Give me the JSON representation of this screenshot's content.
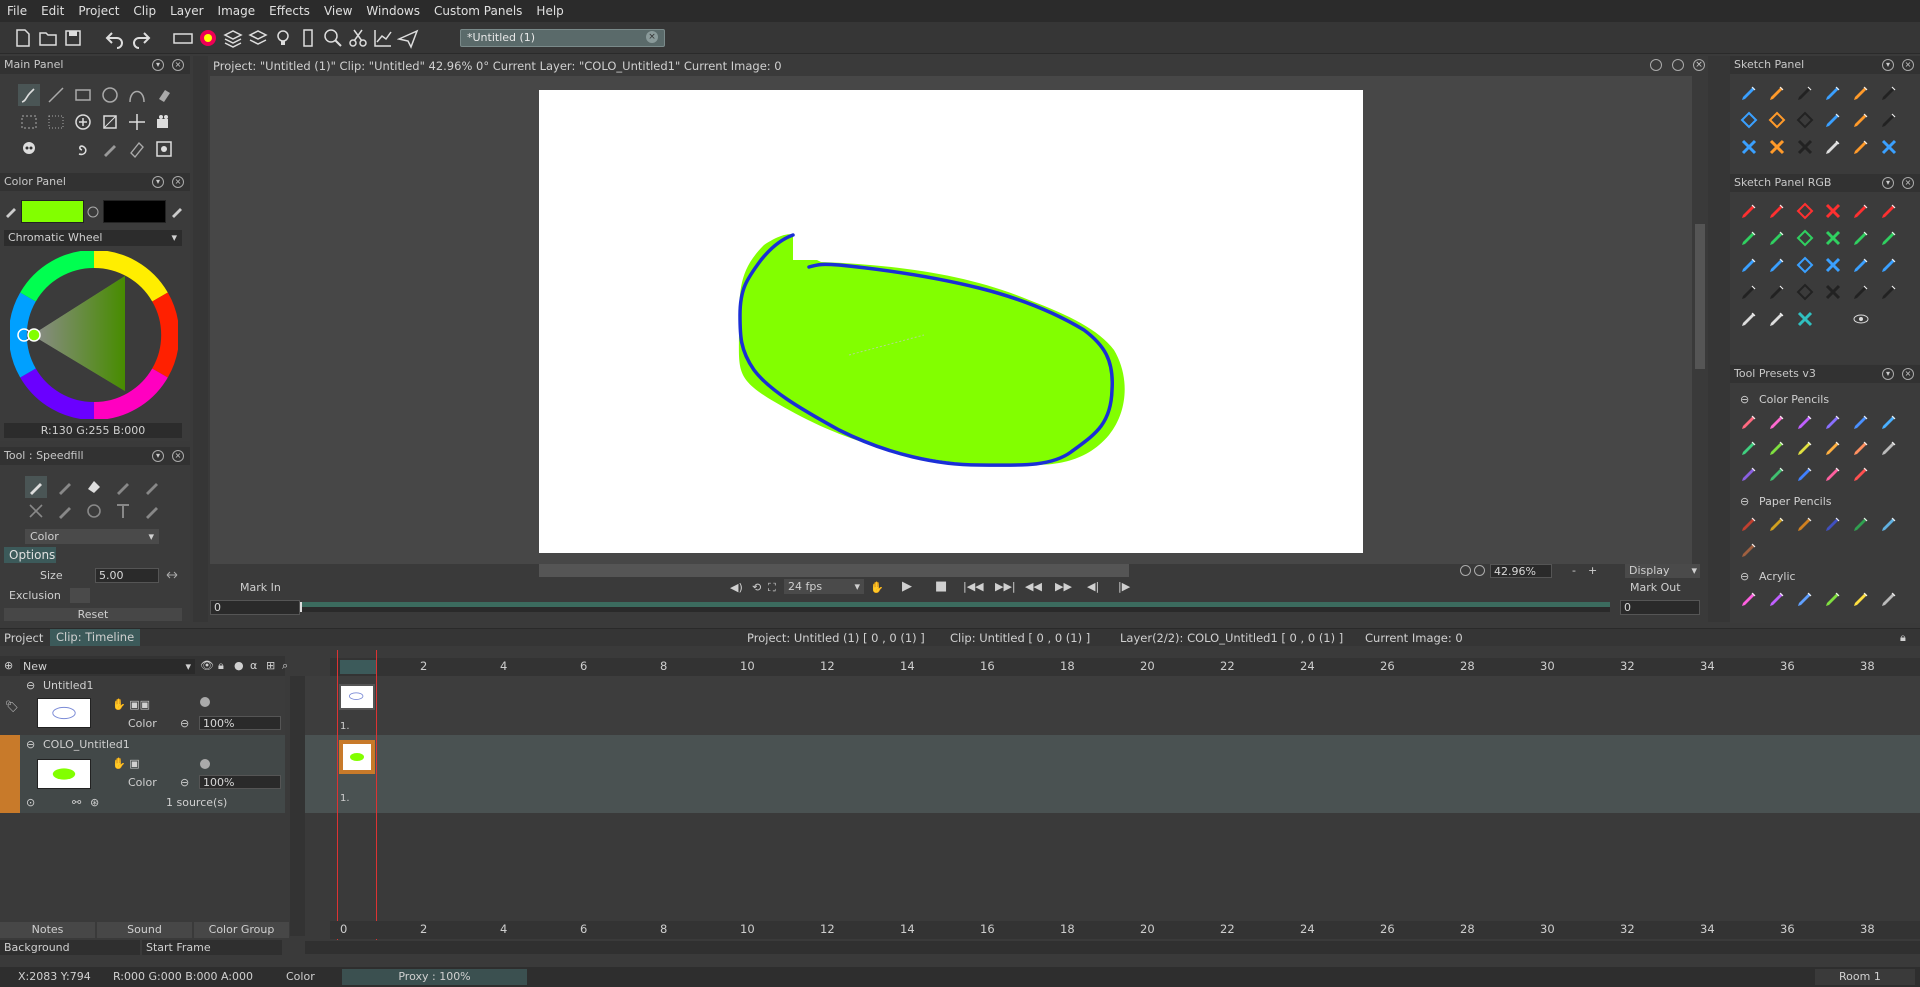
{
  "menu": [
    "File",
    "Edit",
    "Project",
    "Clip",
    "Layer",
    "Image",
    "Effects",
    "View",
    "Windows",
    "Custom Panels",
    "Help"
  ],
  "doc_tab": {
    "title": "*Untitled (1)"
  },
  "panels": {
    "main_panel": "Main Panel",
    "color_panel": "Color Panel",
    "sketch_panel": "Sketch Panel",
    "sketch_panel_rgb": "Sketch Panel RGB",
    "tool_presets": "Tool Presets v3"
  },
  "color_panel": {
    "mode": "Chromatic Wheel",
    "rgb_readout": "R:130 G:255 B:000",
    "primary": "#82ff00",
    "secondary": "#000000"
  },
  "tool_panel": {
    "title": "Tool : Speedfill",
    "mode": "Color",
    "options_tab": "Options",
    "size_label": "Size",
    "size_value": "5.00",
    "exclusion_label": "Exclusion",
    "reset_label": "Reset"
  },
  "viewer": {
    "header": "Project: \"Untitled (1)\"  Clip: \"Untitled\"   42.96%   0°  Current Layer: \"COLO_Untitled1\"  Current Image: 0",
    "zoom": "42.96%",
    "display": "Display",
    "mark_in": "Mark In",
    "mark_out": "Mark Out",
    "mark_in_value": "0",
    "mark_out_value": "0",
    "fps": "24 fps",
    "fill_color": "#82ff00",
    "stroke_color": "#1a2fd6"
  },
  "tool_presets": {
    "section1": "Color Pencils",
    "section2": "Paper Pencils",
    "section3": "Acrylic"
  },
  "timeline": {
    "tab_project": "Project",
    "tab_timeline": "Clip: Timeline",
    "info_project": "Project: Untitled (1) [ 0 , 0  (1) ]",
    "info_clip": "Clip: Untitled [ 0 , 0  (1) ]",
    "info_layer": "Layer(2/2): COLO_Untitled1 [ 0 , 0  (1) ]",
    "info_image": "Current Image: 0",
    "new_layer": "New",
    "ruler": [
      "0",
      "2",
      "4",
      "6",
      "8",
      "10",
      "12",
      "14",
      "16",
      "18",
      "20",
      "22",
      "24",
      "26",
      "28",
      "30",
      "32",
      "34",
      "36",
      "38"
    ],
    "layers": [
      {
        "name": "Untitled1",
        "type": "Color",
        "opacity": "100%",
        "frame_label": "1."
      },
      {
        "name": "COLO_Untitled1",
        "type": "Color",
        "opacity": "100%",
        "frame_label": "1.",
        "sources": "1 source(s)"
      }
    ],
    "bottom_tabs": [
      "Notes",
      "Sound",
      "Color Group"
    ],
    "background_label": "Background",
    "start_frame_label": "Start Frame"
  },
  "status": {
    "coords": "X:2083  Y:794",
    "rgba": "R:000 G:000 B:000 A:000",
    "mode": "Color",
    "proxy": "Proxy : 100%",
    "room": "Room 1"
  }
}
